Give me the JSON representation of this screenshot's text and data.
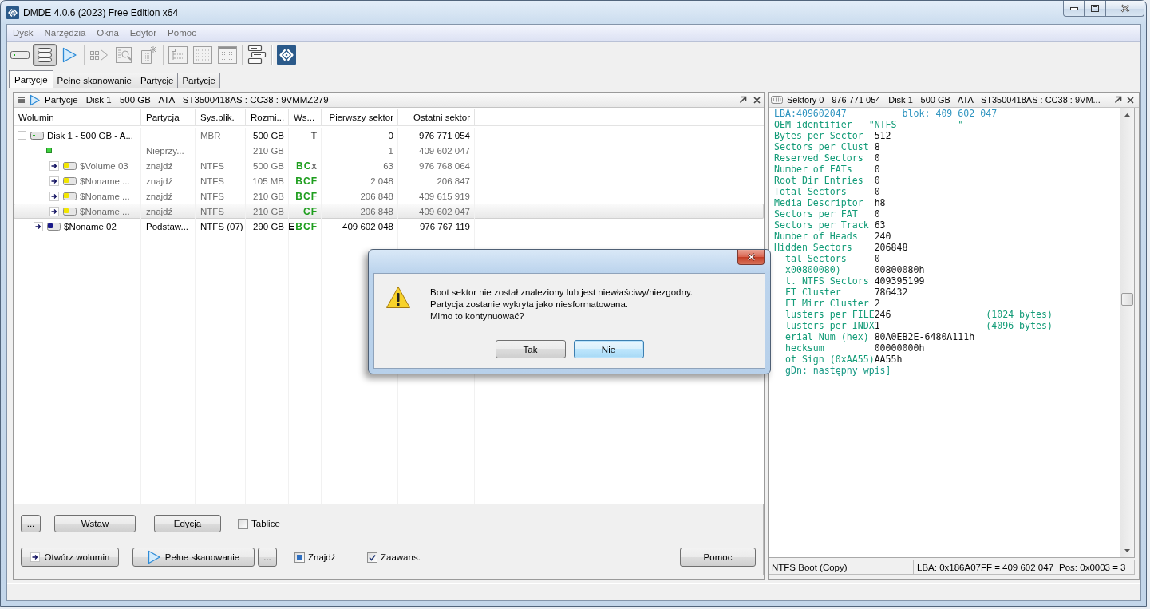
{
  "window": {
    "title": "DMDE 4.0.6 (2023) Free Edition x64"
  },
  "menu": [
    {
      "label": "Dysk",
      "disabled": true
    },
    {
      "label": "Narzędzia",
      "disabled": true
    },
    {
      "label": "Okna",
      "disabled": true
    },
    {
      "label": "Edytor",
      "disabled": true
    },
    {
      "label": "Pomoc",
      "disabled": true
    }
  ],
  "toolbar": {
    "groups": [
      {
        "buttons": [
          {
            "kind": "drive",
            "selected": false,
            "disabled": false
          },
          {
            "kind": "partitions",
            "selected": true,
            "disabled": false
          },
          {
            "kind": "play",
            "selected": false,
            "disabled": false
          }
        ]
      },
      {
        "buttons": [
          {
            "kind": "sectors",
            "selected": false,
            "disabled": true
          },
          {
            "kind": "inspect",
            "selected": false,
            "disabled": true
          },
          {
            "kind": "new_file",
            "selected": false,
            "disabled": true
          }
        ]
      },
      {
        "buttons": [
          {
            "kind": "tree",
            "selected": false,
            "disabled": true
          },
          {
            "kind": "list",
            "selected": false,
            "disabled": true
          },
          {
            "kind": "grid",
            "selected": false,
            "disabled": true
          }
        ]
      },
      {
        "buttons": [
          {
            "kind": "panels",
            "selected": false,
            "disabled": false
          }
        ]
      },
      {
        "buttons": [
          {
            "kind": "logo",
            "selected": false,
            "disabled": false
          }
        ]
      }
    ]
  },
  "tabs": [
    {
      "label": "Partycje",
      "selected": true
    },
    {
      "label": "Pełne skanowanie",
      "selected": false
    },
    {
      "label": "Partycje",
      "selected": false
    },
    {
      "label": "Partycje",
      "selected": false
    }
  ],
  "partitions_panel": {
    "title": "Partycje - Disk 1 - 500 GB - ATA - ST3500418AS : CC38 : 9VMMZ279",
    "columns": [
      "Wolumin",
      "Partycja",
      "Sys.plik.",
      "Rozmi...",
      "Ws...",
      "Pierwszy sektor",
      "Ostatni sektor"
    ],
    "rows": [
      {
        "kind": "disk",
        "selected": false,
        "dimmed": false,
        "name": "Disk 1 - 500 GB - A...",
        "filesystem": "MBR",
        "filesystem_dimmed": true,
        "size": "500 GB",
        "flags": [
          {
            "letter": "T",
            "color": "#000000"
          }
        ],
        "first_sector": "0",
        "last_sector": "976 771 054",
        "children": [
          {
            "kind": "unallocated",
            "selected": false,
            "dimmed": true,
            "partition": "Nieprzy...",
            "size": "210 GB",
            "first_sector": "1",
            "last_sector": "409 602 047",
            "children": [
              {
                "kind": "found_volume",
                "selected": false,
                "dimmed": true,
                "name": "$Volume 03",
                "partition": "znajdź",
                "filesystem": "NTFS",
                "size": "500 GB",
                "flags": [
                  {
                    "letter": "B",
                    "color": "#1e9e1e"
                  },
                  {
                    "letter": "C",
                    "color": "#1e9e1e"
                  },
                  {
                    "letter": "x",
                    "color": "#707070"
                  }
                ],
                "first_sector": "63",
                "last_sector": "976 768 064"
              },
              {
                "kind": "found_volume",
                "selected": false,
                "dimmed": true,
                "name": "$Noname ...",
                "partition": "znajdź",
                "filesystem": "NTFS",
                "size": "105 MB",
                "flags": [
                  {
                    "letter": "B",
                    "color": "#1e9e1e"
                  },
                  {
                    "letter": "C",
                    "color": "#1e9e1e"
                  },
                  {
                    "letter": "F",
                    "color": "#1e9e1e"
                  }
                ],
                "first_sector": "2 048",
                "last_sector": "206 847"
              },
              {
                "kind": "found_volume",
                "selected": false,
                "dimmed": true,
                "name": "$Noname ...",
                "partition": "znajdź",
                "filesystem": "NTFS",
                "size": "210 GB",
                "flags": [
                  {
                    "letter": "B",
                    "color": "#1e9e1e"
                  },
                  {
                    "letter": "C",
                    "color": "#1e9e1e"
                  },
                  {
                    "letter": "F",
                    "color": "#1e9e1e"
                  }
                ],
                "first_sector": "206 848",
                "last_sector": "409 615 919"
              },
              {
                "kind": "found_volume",
                "selected": true,
                "dimmed": true,
                "name": "$Noname ...",
                "partition": "znajdź",
                "filesystem": "NTFS",
                "size": "210 GB",
                "flags": [
                  {
                    "letter": "C",
                    "color": "#1e9e1e"
                  },
                  {
                    "letter": "F",
                    "color": "#1e9e1e"
                  }
                ],
                "first_sector": "206 848",
                "last_sector": "409 602 047"
              }
            ]
          },
          {
            "kind": "volume",
            "selected": false,
            "dimmed": false,
            "name": "$Noname 02",
            "partition": "Podstaw...",
            "filesystem": "NTFS (07)",
            "filesystem_dimmed": false,
            "size": "290 GB",
            "flags": [
              {
                "letter": "E",
                "color": "#000000"
              },
              {
                "letter": "B",
                "color": "#1e9e1e"
              },
              {
                "letter": "C",
                "color": "#1e9e1e"
              },
              {
                "letter": "F",
                "color": "#1e9e1e"
              }
            ],
            "first_sector": "409 602 048",
            "last_sector": "976 767 119"
          }
        ]
      }
    ],
    "actions": [
      [
        {
          "kind": "more",
          "label": "..."
        },
        {
          "kind": "plain",
          "label": "Wstaw"
        },
        {
          "kind": "plain",
          "label": "Edycja"
        },
        {
          "kind": "checkbox",
          "label": "Tablice",
          "checked": false
        }
      ],
      [
        {
          "kind": "open",
          "label": "Otwórz wolumin"
        },
        {
          "kind": "scan",
          "label": "Pełne skanowanie"
        },
        {
          "kind": "more",
          "label": "..."
        },
        {
          "kind": "checkbox",
          "label": "Znajdź",
          "checked": false,
          "indeterminate": true
        },
        {
          "kind": "checkbox",
          "label": "Zaawans.",
          "checked": true
        },
        {
          "kind": "help",
          "label": "Pomoc"
        }
      ]
    ]
  },
  "sectors_panel": {
    "title": "Sektory 0 - 976 771 054 - Disk 1 - 500 GB - ATA - ST3500418AS : CC38 : 9VM...",
    "lines": [
      {
        "kind": "address",
        "label": "LBA:409602047",
        "value": "blok: 409 602 047",
        "covered": false
      },
      {
        "kind": "text",
        "label": "OEM identifier",
        "value": "\"NTFS           \"",
        "covered": false
      },
      {
        "kind": "field",
        "label": "Bytes per Sector",
        "value": "512",
        "covered": false
      },
      {
        "kind": "field",
        "label": "Sectors per Clust",
        "value": "8",
        "covered": false
      },
      {
        "kind": "field",
        "label": "Reserved Sectors",
        "value": "0",
        "covered": false
      },
      {
        "kind": "field",
        "label": "Number of FATs",
        "value": "0",
        "covered": false
      },
      {
        "kind": "field",
        "label": "Root Dir Entries",
        "value": "0",
        "covered": false
      },
      {
        "kind": "field",
        "label": "Total Sectors",
        "value": "0",
        "covered": false
      },
      {
        "kind": "field",
        "label": "Media Descriptor",
        "value": "h8",
        "covered": false
      },
      {
        "kind": "field",
        "label": "Sectors per FAT",
        "value": "0",
        "covered": false
      },
      {
        "kind": "field",
        "label": "Sectors per Track",
        "value": "63",
        "covered": false
      },
      {
        "kind": "field",
        "label": "Number of Heads",
        "value": "240",
        "covered": false
      },
      {
        "kind": "field",
        "label": "Hidden Sectors",
        "value": "206848",
        "covered": false
      },
      {
        "kind": "field",
        "label": "tal Sectors",
        "value": "0",
        "covered": true
      },
      {
        "kind": "field",
        "label": "x00800080)",
        "value": "00800080h",
        "covered": true
      },
      {
        "kind": "field",
        "label": "t. NTFS Sectors",
        "value": "409395199",
        "covered": true
      },
      {
        "kind": "field",
        "label": "FT Cluster",
        "value": "786432",
        "covered": true
      },
      {
        "kind": "field",
        "label": "FT Mirr Cluster",
        "value": "2",
        "covered": true
      },
      {
        "kind": "field",
        "label": "lusters per FILE",
        "value": "246",
        "note": "(1024 bytes)",
        "covered": true
      },
      {
        "kind": "field",
        "label": "lusters per INDX",
        "value": "1",
        "note": "(4096 bytes)",
        "covered": true
      },
      {
        "kind": "field",
        "label": "erial Num (hex)",
        "value": "80A0EB2E-6480A111h",
        "covered": true
      },
      {
        "kind": "field",
        "label": "hecksum",
        "value": "00000000h",
        "covered": true
      },
      {
        "kind": "field",
        "label": "ot Sign (0xAA55)",
        "value": "AA55h",
        "covered": true
      },
      {
        "kind": "hint",
        "label": "gDn: następny wpis]",
        "covered": true
      }
    ],
    "status": [
      "NTFS Boot (Copy)",
      "LBA: 0x186A07FF = 409 602 047",
      "Pos: 0x0003 = 3"
    ]
  },
  "dialog": {
    "message": [
      "Boot sektor nie został znaleziony lub jest niewłaściwy/niezgodny.",
      "Partycja zostanie wykryta jako niesformatowana.",
      "Mimo to kontynuować?"
    ],
    "buttons": [
      {
        "label": "Tak",
        "default": false
      },
      {
        "label": "Nie",
        "default": true
      }
    ]
  }
}
